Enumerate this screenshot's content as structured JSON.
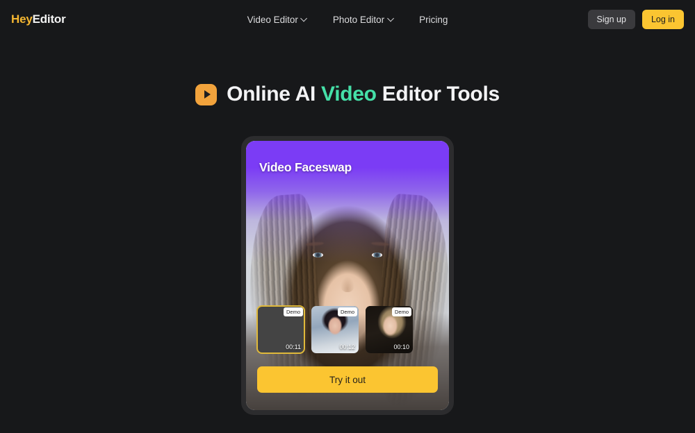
{
  "header": {
    "logo": {
      "part1": "Hey",
      "part2": "Editor",
      "icon": "brand-logo"
    },
    "nav": [
      {
        "label": "Video Editor",
        "has_dropdown": true
      },
      {
        "label": "Photo Editor",
        "has_dropdown": true
      },
      {
        "label": "Pricing",
        "has_dropdown": false
      }
    ],
    "signup_label": "Sign up",
    "login_label": "Log in"
  },
  "hero": {
    "icon": "play-badge-icon",
    "title_before": "Online AI ",
    "title_highlight": "Video",
    "title_after": " Editor Tools"
  },
  "card": {
    "title": "Video Faceswap",
    "cta_label": "Try it out",
    "thumbnails": [
      {
        "badge": "Demo",
        "duration": "00:11",
        "selected": true,
        "alt": "woman-with-long-brown-hair"
      },
      {
        "badge": "Demo",
        "duration": "00:12",
        "selected": false,
        "alt": "person-with-curly-dark-hair"
      },
      {
        "badge": "Demo",
        "duration": "00:10",
        "selected": false,
        "alt": "blonde-woman-dark-background"
      }
    ]
  },
  "colors": {
    "page_bg": "#17181a",
    "brand_yellow": "#fbc531",
    "accent_green": "#45e0a8",
    "accent_purple": "#7b3cf5",
    "play_orange": "#f2a33c",
    "signup_gray": "#3a3a3d",
    "selected_border": "#e0b93a"
  }
}
